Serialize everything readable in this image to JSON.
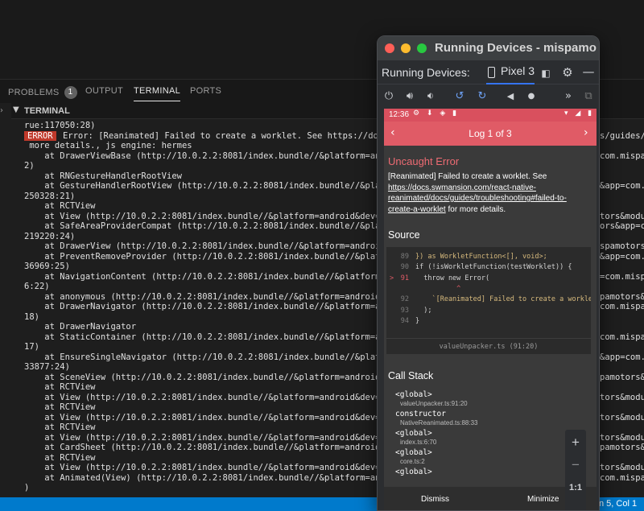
{
  "panel": {
    "tabs": [
      {
        "label": "PROBLEMS",
        "badge": "1"
      },
      {
        "label": "OUTPUT"
      },
      {
        "label": "TERMINAL"
      },
      {
        "label": "PORTS"
      }
    ],
    "section_title": "TERMINAL"
  },
  "terminal": {
    "lines": [
      "rue:117050:28)",
      "Error: [Reanimated] Failed to create a worklet. See https://do",
      " more details., js engine: hermes",
      "    at DrawerViewBase (http://10.0.2.2:8081/index.bundle//&platform=an",
      "2)",
      "    at RNGestureHandlerRootView",
      "    at GestureHandlerRootView (http://10.0.2.2:8081/index.bundle//&pla",
      "250328:21)",
      "    at RCTView",
      "    at View (http://10.0.2.2:8081/index.bundle//&platform=android&dev=",
      "    at SafeAreaProviderCompat (http://10.0.2.2:8081/index.bundle//&pla",
      "219220:24)",
      "    at DrawerView (http://10.0.2.2:8081/index.bundle//&platform=androi",
      "    at PreventRemoveProvider (http://10.0.2.2:8081/index.bundle//&platf",
      "36969:25)",
      "    at NavigationContent (http://10.0.2.2:8081/index.bundle//&platform",
      "6:22)",
      "    at anonymous (http://10.0.2.2:8081/index.bundle//&platform=android",
      "    at DrawerNavigator (http://10.0.2.2:8081/index.bundle//&platform=a",
      "18)",
      "    at DrawerNavigator",
      "    at StaticContainer (http://10.0.2.2:8081/index.bundle//&platform=a",
      "17)",
      "    at EnsureSingleNavigator (http://10.0.2.2:8081/index.bundle//&platf",
      "33877:24)",
      "    at SceneView (http://10.0.2.2:8081/index.bundle//&platform=android",
      "    at RCTView",
      "    at View (http://10.0.2.2:8081/index.bundle//&platform=android&dev=",
      "    at RCTView",
      "    at View (http://10.0.2.2:8081/index.bundle//&platform=android&dev=",
      "    at RCTView",
      "    at View (http://10.0.2.2:8081/index.bundle//&platform=android&dev=",
      "    at CardSheet (http://10.0.2.2:8081/index.bundle//&platform=android",
      "    at RCTView",
      "    at View (http://10.0.2.2:8081/index.bundle//&platform=android&dev=",
      "    at Animated(View) (http://10.0.2.2:8081/index.bundle//&platform=an",
      ")"
    ],
    "error_tag": "ERROR",
    "right_column": [
      {
        "row": 1,
        "text": "s/guides/"
      },
      {
        "row": 3,
        "text": "com.mispamo"
      },
      {
        "row": 6,
        "text": "&app=com."
      },
      {
        "row": 9,
        "text": "tors&modul"
      },
      {
        "row": 10,
        "text": "ors&app=c"
      },
      {
        "row": 12,
        "text": "spamotors"
      },
      {
        "row": 13,
        "text": "&app=com."
      },
      {
        "row": 15,
        "text": "=com.misp"
      },
      {
        "row": 17,
        "text": "pamotors&"
      },
      {
        "row": 18,
        "text": "com.mispam"
      },
      {
        "row": 21,
        "text": "com.mispam"
      },
      {
        "row": 23,
        "text": "&app=com."
      },
      {
        "row": 25,
        "text": "pamotors&"
      },
      {
        "row": 27,
        "text": "tors&modul"
      },
      {
        "row": 29,
        "text": "tors&modul"
      },
      {
        "row": 31,
        "text": "tors&modul"
      },
      {
        "row": 32,
        "text": "pamotors&"
      },
      {
        "row": 34,
        "text": "tors&modul"
      },
      {
        "row": 35,
        "text": "com.mispam"
      }
    ]
  },
  "statusbar": {
    "position": "n 5, Col 1"
  },
  "devices_window": {
    "title": "Running Devices - mispamo",
    "label": "Running Devices:",
    "device_tab": "Pixel 3"
  },
  "phone": {
    "time": "12:36",
    "log_header": "Log 1 of 3",
    "error_title": "Uncaught Error",
    "error_message_prefix": "[Reanimated] Failed to create a worklet. See ",
    "error_link": "https://docs.swmansion.com/react-native-reanimated/docs/guides/troubleshooting#failed-to-create-a-worklet",
    "error_message_suffix": " for more details.",
    "source_heading": "Source",
    "source_lines": [
      {
        "num": "89",
        "marker": "",
        "code": "}) as WorkletFunction<[], void>;"
      },
      {
        "num": "90",
        "marker": "",
        "code": "if (!isWorkletFunction(testWorklet)) {"
      },
      {
        "num": "91",
        "marker": ">",
        "code": "  throw new Error("
      },
      {
        "num": "",
        "marker": "",
        "code": "          ^"
      },
      {
        "num": "92",
        "marker": "",
        "code": "    `[Reanimated] Failed to create a workle"
      },
      {
        "num": "93",
        "marker": "",
        "code": "  );"
      },
      {
        "num": "94",
        "marker": "",
        "code": "}"
      }
    ],
    "source_file": "valueUnpacker.ts (91:20)",
    "callstack_heading": "Call Stack",
    "frames": [
      {
        "fn": "<global>",
        "loc": "valueUnpacker.ts:91:20"
      },
      {
        "fn": "constructor",
        "loc": "NativeReanimated.ts:88:33"
      },
      {
        "fn": "<global>",
        "loc": "index.ts:6:70"
      },
      {
        "fn": "<global>",
        "loc": "core.ts:2"
      },
      {
        "fn": "<global>",
        "loc": ""
      }
    ],
    "dismiss": "Dismiss",
    "minimize": "Minimize"
  },
  "zoom": {
    "plus": "+",
    "minus": "−",
    "ratio": "1:1"
  },
  "colors": {
    "vscode_bg": "#1e1e1e",
    "status_blue": "#007acc",
    "error_red": "#e05b66",
    "accent": "#3574f0"
  }
}
